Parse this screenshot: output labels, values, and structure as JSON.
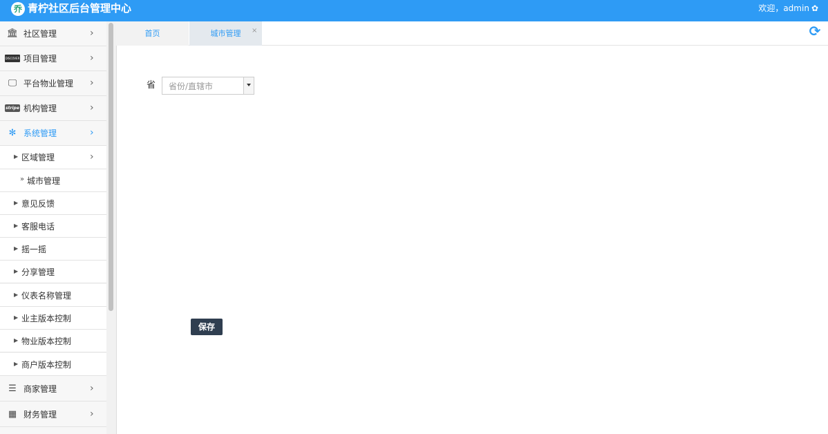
{
  "header": {
    "logo_glyph": "乔",
    "title": "青柠社区后台管理中心",
    "welcome": "欢迎，admin",
    "settings_icon": "gear-icon"
  },
  "sidebar": {
    "top_items": [
      {
        "label": "社区管理",
        "icon": "bank-icon"
      },
      {
        "label": "项目管理",
        "icon": "credit-card-icon"
      },
      {
        "label": "平台物业管理",
        "icon": "monitor-icon"
      },
      {
        "label": "机构管理",
        "icon": "stripe-icon"
      },
      {
        "label": "系统管理",
        "icon": "yelp-icon"
      }
    ],
    "sub_items": [
      {
        "label": "区域管理"
      },
      {
        "label": "城市管理"
      },
      {
        "label": "意见反馈"
      },
      {
        "label": "客服电话"
      },
      {
        "label": "摇一摇"
      },
      {
        "label": "分享管理"
      },
      {
        "label": "仪表名称管理"
      },
      {
        "label": "业主版本控制"
      },
      {
        "label": "物业版本控制"
      },
      {
        "label": "商户版本控制"
      }
    ],
    "bottom_items": [
      {
        "label": "商家管理",
        "icon": "list-icon"
      },
      {
        "label": "财务管理",
        "icon": "calculator-icon"
      }
    ],
    "icon_text": {
      "card": "DISCOVER",
      "stripe": "stripe"
    }
  },
  "tabs": [
    {
      "label": "首页"
    },
    {
      "label": "城市管理"
    }
  ],
  "tab_close": "×",
  "form": {
    "province_label": "省",
    "province_placeholder": "省份/直辖市",
    "save_label": "保存"
  },
  "colors": {
    "header_bg": "#2e9bf5",
    "accent": "#2e9bf5",
    "save_button": "#2f3e50"
  }
}
